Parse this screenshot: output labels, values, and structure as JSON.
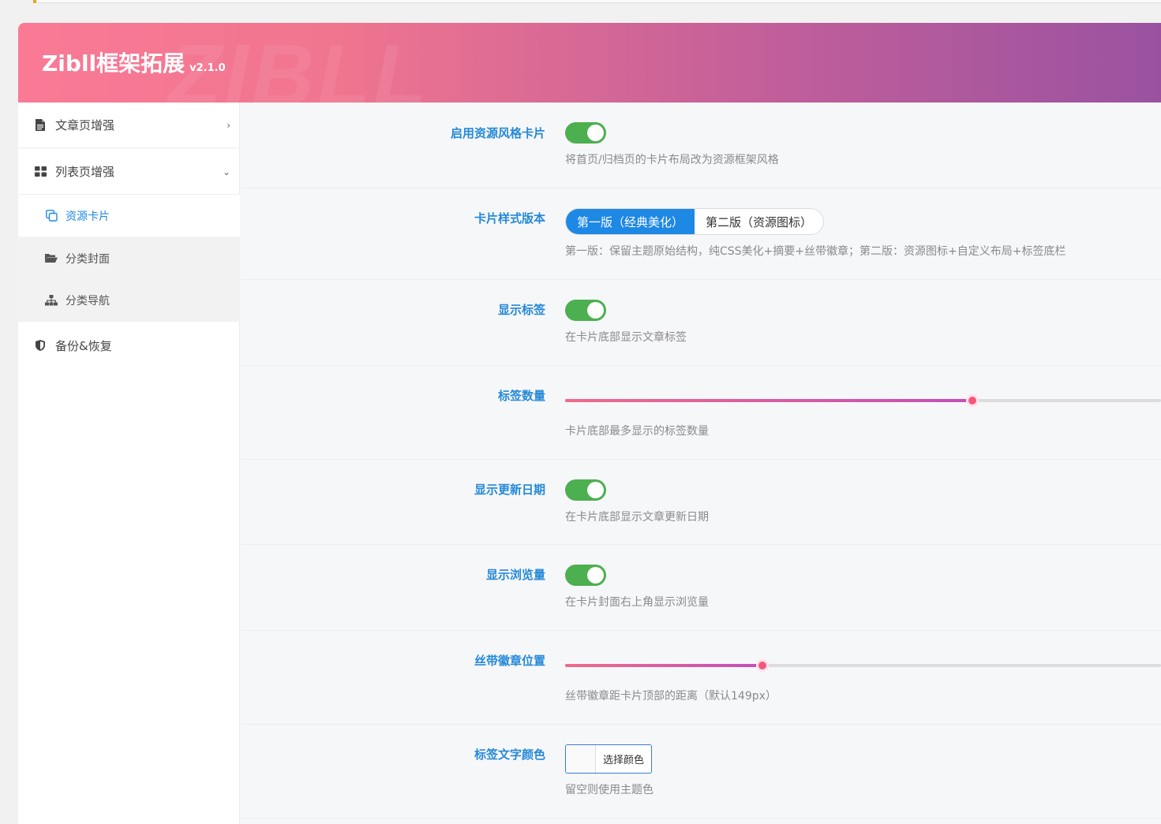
{
  "header": {
    "title": "Zibll框架拓展",
    "version": "v2.1.0",
    "watermark": "ZIBLL"
  },
  "sidebar": {
    "items": [
      {
        "label": "文章页增强",
        "icon": "document-icon",
        "chevron": "›"
      },
      {
        "label": "列表页增强",
        "icon": "grid-icon",
        "chevron": "⌄"
      },
      {
        "label": "备份&恢复",
        "icon": "shield-icon"
      }
    ],
    "subitems": [
      {
        "label": "资源卡片",
        "icon": "copy-icon",
        "active": true
      },
      {
        "label": "分类封面",
        "icon": "folder-open-icon"
      },
      {
        "label": "分类导航",
        "icon": "sitemap-icon"
      }
    ]
  },
  "settings": {
    "resource_card": {
      "label": "启用资源风格卡片",
      "enabled": true,
      "desc": "将首页/归档页的卡片布局改为资源框架风格"
    },
    "card_style": {
      "label": "卡片样式版本",
      "options": [
        "第一版（经典美化）",
        "第二版（资源图标）"
      ],
      "selected": "第一版（经典美化）",
      "desc": "第一版：保留主题原始结构，纯CSS美化+摘要+丝带徽章；第二版：资源图标+自定义布局+标签底栏"
    },
    "show_tags": {
      "label": "显示标签",
      "enabled": true,
      "desc": "在卡片底部显示文章标签"
    },
    "tag_count": {
      "label": "标签数量",
      "slider_fraction": 0.683,
      "desc": "卡片底部最多显示的标签数量"
    },
    "show_update_date": {
      "label": "显示更新日期",
      "enabled": true,
      "desc": "在卡片底部显示文章更新日期"
    },
    "show_views": {
      "label": "显示浏览量",
      "enabled": true,
      "desc": "在卡片封面右上角显示浏览量"
    },
    "ribbon_position": {
      "label": "丝带徽章位置",
      "slider_fraction": 0.331,
      "desc": "丝带徽章距卡片顶部的距离（默认149px）"
    },
    "tag_text_color": {
      "label": "标签文字颜色",
      "button": "选择颜色",
      "desc": "留空则使用主题色"
    }
  },
  "colors": {
    "accent": "#1e88e5",
    "toggle_on": "#4caf50",
    "slider_thumb": "#f2587e",
    "label": "#2589d8"
  }
}
